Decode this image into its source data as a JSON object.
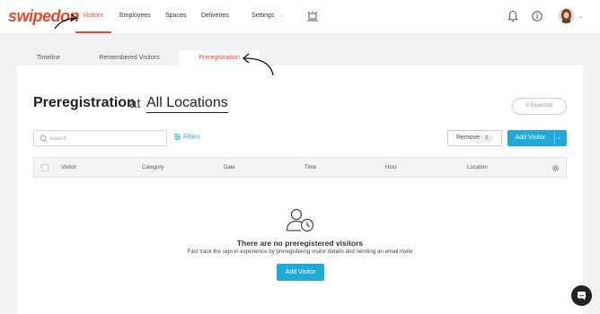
{
  "app": {
    "logo": "swipedon"
  },
  "nav": {
    "items": [
      {
        "label": "Visitors",
        "active": true
      },
      {
        "label": "Employees"
      },
      {
        "label": "Spaces"
      },
      {
        "label": "Deliveries"
      },
      {
        "label": "Settings"
      }
    ]
  },
  "subtabs": [
    {
      "label": "Timeline"
    },
    {
      "label": "Remembered Visitors"
    },
    {
      "label": "Preregistration",
      "active": true
    }
  ],
  "header": {
    "title": "Preregistration",
    "at": "at",
    "location": "All Locations",
    "expected_count": "0",
    "expected_label": "Expected"
  },
  "toolbar": {
    "search_placeholder": "Search",
    "filters_label": "Filters",
    "remove_label": "Remove",
    "remove_count": "0",
    "add_visitor_label": "Add Visitor"
  },
  "table": {
    "columns": [
      "Visitor",
      "Category",
      "Date",
      "Time",
      "Host",
      "Location"
    ]
  },
  "empty_state": {
    "title": "There are no preregistered visitors",
    "subtitle": "Fast track the sign in experience by preregistering visitor details and sending an email invite",
    "button_label": "Add Visitor"
  },
  "colors": {
    "brand": "#e8472c",
    "accent": "#21a9d9"
  }
}
